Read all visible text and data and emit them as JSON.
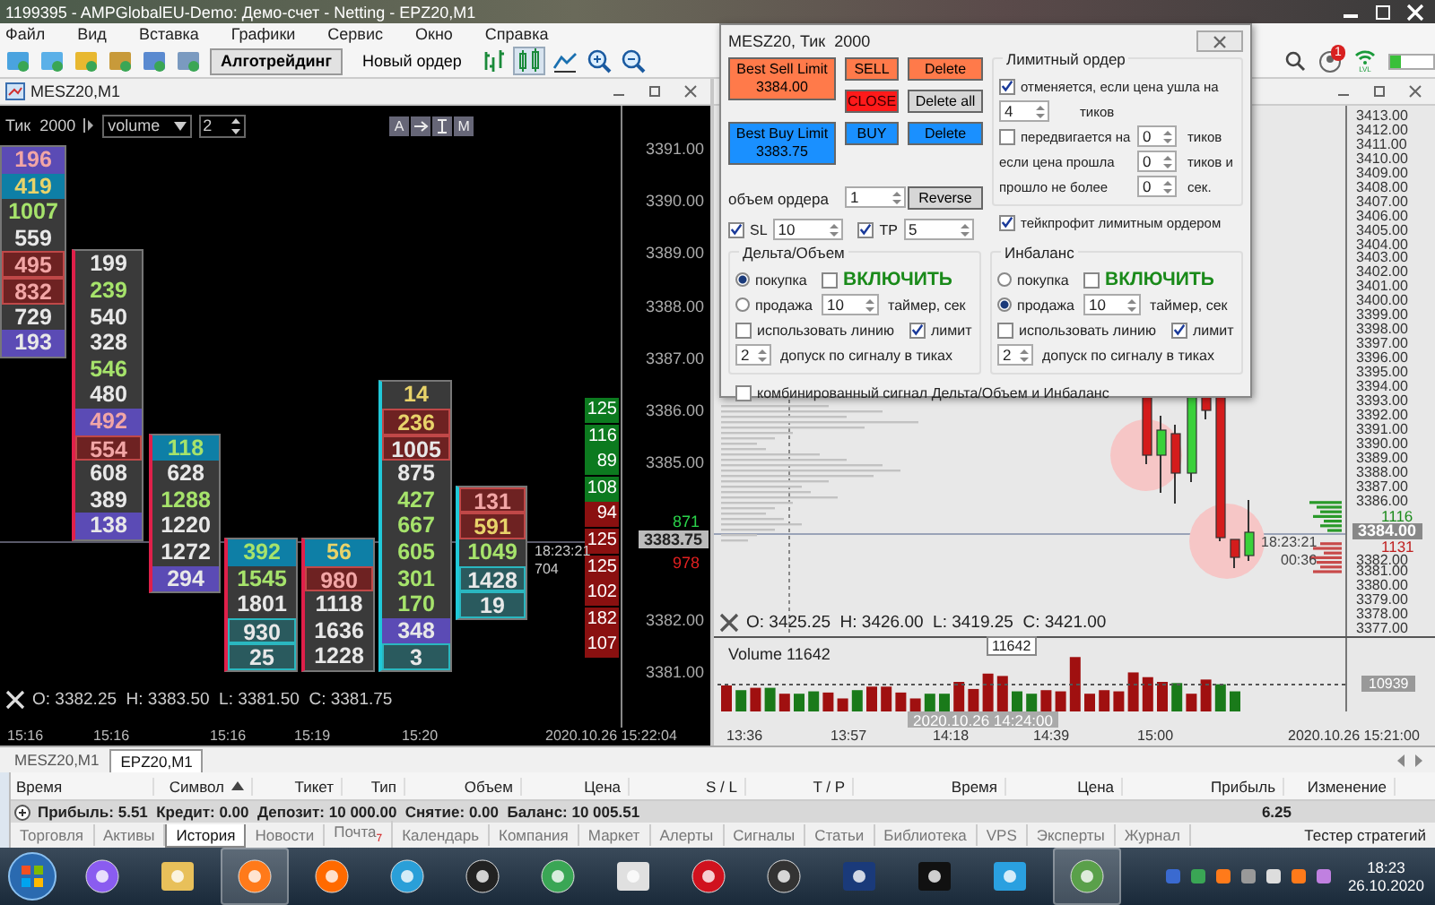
{
  "window": {
    "title": "1199395 - AMPGlobalEU-Demo: Демо-счет - Netting - EPZ20,M1"
  },
  "menu": [
    "Файл",
    "Вид",
    "Вставка",
    "Графики",
    "Сервис",
    "Окно",
    "Справка"
  ],
  "toolbar": {
    "buttons": [
      {
        "label": "Алготрейдинг",
        "selected": true
      },
      {
        "label": "Новый ордер",
        "selected": false
      }
    ],
    "notifications": "1",
    "signal_label": "LVL"
  },
  "left_chart": {
    "title": "MESZ20,M1",
    "period": "Тик  2000",
    "mode": "volume",
    "step": "2",
    "tools": [
      "A",
      "M"
    ],
    "columns": [
      {
        "kind": "plain",
        "cells": [
          {
            "value": "196",
            "kind": "purple-pink"
          },
          {
            "value": "419",
            "kind": "cyan-yellow"
          },
          {
            "value": "1007",
            "kind": "plain-green"
          },
          {
            "value": "559",
            "kind": "plain-white"
          },
          {
            "value": "495",
            "kind": "red-pink"
          },
          {
            "value": "832",
            "kind": "red-pink"
          },
          {
            "value": "729",
            "kind": "plain-white"
          },
          {
            "value": "193",
            "kind": "purple-white"
          }
        ]
      },
      {
        "kind": "sell",
        "cells": [
          {
            "value": "199",
            "kind": "plain-white"
          },
          {
            "value": "239",
            "kind": "plain-green"
          },
          {
            "value": "540",
            "kind": "plain-white"
          },
          {
            "value": "328",
            "kind": "plain-white"
          },
          {
            "value": "546",
            "kind": "plain-green"
          },
          {
            "value": "480",
            "kind": "plain-white"
          },
          {
            "value": "492",
            "kind": "purple-pink"
          },
          {
            "value": "554",
            "kind": "red-pink"
          },
          {
            "value": "608",
            "kind": "plain-white"
          },
          {
            "value": "389",
            "kind": "plain-white"
          },
          {
            "value": "138",
            "kind": "purple-white"
          }
        ]
      },
      {
        "kind": "sell",
        "cells": [
          {
            "value": "118",
            "kind": "cyan-green"
          },
          {
            "value": "628",
            "kind": "plain-white"
          },
          {
            "value": "1288",
            "kind": "plain-green"
          },
          {
            "value": "1220",
            "kind": "plain-white"
          },
          {
            "value": "1272",
            "kind": "plain-white"
          },
          {
            "value": "294",
            "kind": "purple-white"
          }
        ]
      },
      {
        "kind": "sell",
        "cells": [
          {
            "value": "392",
            "kind": "cyan-green"
          },
          {
            "value": "1545",
            "kind": "plain-green"
          },
          {
            "value": "1801",
            "kind": "plain-white"
          },
          {
            "value": "930",
            "kind": "teal-white"
          },
          {
            "value": "25",
            "kind": "teal-white"
          }
        ]
      },
      {
        "kind": "sell",
        "cells": [
          {
            "value": "56",
            "kind": "cyan-yellow"
          },
          {
            "value": "980",
            "kind": "red-pink"
          },
          {
            "value": "1118",
            "kind": "plain-white"
          },
          {
            "value": "1636",
            "kind": "plain-white"
          },
          {
            "value": "1228",
            "kind": "plain-white"
          }
        ]
      },
      {
        "kind": "buy",
        "cells": [
          {
            "value": "14",
            "kind": "plain-yellow"
          },
          {
            "value": "236",
            "kind": "red-yellow"
          },
          {
            "value": "1005",
            "kind": "red-white"
          },
          {
            "value": "875",
            "kind": "plain-white"
          },
          {
            "value": "427",
            "kind": "plain-green"
          },
          {
            "value": "667",
            "kind": "plain-green"
          },
          {
            "value": "605",
            "kind": "plain-green"
          },
          {
            "value": "301",
            "kind": "plain-green"
          },
          {
            "value": "170",
            "kind": "plain-green"
          },
          {
            "value": "348",
            "kind": "purple-white"
          },
          {
            "value": "3",
            "kind": "teal-white"
          }
        ]
      },
      {
        "kind": "buy",
        "cells": [
          {
            "value": "131",
            "kind": "red-pink"
          },
          {
            "value": "591",
            "kind": "red-yellow"
          },
          {
            "value": "1049",
            "kind": "plain-green"
          },
          {
            "value": "1428",
            "kind": "teal-white"
          },
          {
            "value": "19",
            "kind": "teal-white"
          }
        ]
      }
    ],
    "dom": [
      {
        "value": "125",
        "kind": "buy"
      },
      {
        "value": "116",
        "kind": "buy"
      },
      {
        "value": "89",
        "kind": "buy"
      },
      {
        "value": "108",
        "kind": "buy"
      },
      {
        "value": "94",
        "kind": "sell"
      },
      {
        "value": "125",
        "kind": "sell"
      },
      {
        "value": "125",
        "kind": "sell"
      },
      {
        "value": "102",
        "kind": "sell"
      },
      {
        "value": "182",
        "kind": "sell"
      },
      {
        "value": "107",
        "kind": "sell"
      }
    ],
    "price_labels": [
      "3391.00",
      "3390.00",
      "3389.00",
      "3388.00",
      "3387.00",
      "3386.00",
      "3385.00",
      "3382.00",
      "3381.00"
    ],
    "last_price": "3383.75",
    "bid_volume": "871",
    "ask_volume": "978",
    "time": "18:23:21",
    "tick_count": "704",
    "ohlc": "O: 3382.25  H: 3383.50  L: 3381.50  C: 3381.75",
    "time_labels": [
      "15:16",
      "15:16",
      "15:16",
      "15:19",
      "15:20",
      "2020.10.26 15:22:04"
    ]
  },
  "right_chart": {
    "price_labels": [
      "3413.00",
      "3412.00",
      "3411.00",
      "3410.00",
      "3409.00",
      "3408.00",
      "3407.00",
      "3406.00",
      "3405.00",
      "3404.00",
      "3403.00",
      "3402.00",
      "3401.00",
      "3400.00",
      "3399.00",
      "3398.00",
      "3397.00",
      "3396.00",
      "3395.00",
      "3394.00",
      "3393.00",
      "3392.00",
      "3391.00",
      "3390.00",
      "3389.00",
      "3388.00",
      "3387.00",
      "3386.00",
      "3382.00",
      "3381.00",
      "3380.00",
      "3379.00",
      "3378.00",
      "3377.00"
    ],
    "last_price": "3384.00",
    "bid_volume": "1116",
    "ask_volume": "1131",
    "time": "18:23:21",
    "countdown": "00:36",
    "ohlc": "O: 3425.25  H: 3426.00  L: 3419.25  C: 3421.00",
    "volume_title": "Volume 11642",
    "volume_tooltip": "11642",
    "volume_level": "10939",
    "cursor_date": "2020.10.26 14:24:00",
    "time_labels": [
      "13:36",
      "13:57",
      "14:18",
      "14:39",
      "15:00",
      "2020.10.26 15:21:00"
    ]
  },
  "order_dialog": {
    "title": "MESZ20, Тик  2000",
    "buttons": [
      {
        "label": "Best Sell Limit",
        "price": "3384.00",
        "kind": "sell"
      },
      {
        "label": "SELL",
        "kind": "sell"
      },
      {
        "label": "Delete",
        "kind": "sell"
      },
      {
        "label": "CLOSE",
        "kind": "close"
      },
      {
        "label": "Delete all",
        "kind": "neutral"
      },
      {
        "label": "Best Buy Limit",
        "price": "3383.75",
        "kind": "buy"
      },
      {
        "label": "BUY",
        "kind": "buy"
      },
      {
        "label": "Delete",
        "kind": "buy"
      },
      {
        "label": "Reverse",
        "kind": "neutral"
      }
    ],
    "volume": {
      "label": "объем ордера",
      "value": "1"
    },
    "sl": {
      "label": "SL",
      "checked": true,
      "value": "10"
    },
    "tp": {
      "label": "TP",
      "checked": true,
      "value": "5"
    },
    "limit_order": {
      "title": "Лимитный ордер",
      "cancel": {
        "label": "отменяется, если цена ушла на",
        "checked": true,
        "value": "4",
        "unit": "тиков"
      },
      "move": {
        "label": "передвигается на",
        "checked": false,
        "value": "0",
        "unit": "тиков"
      },
      "passed": {
        "label": "если цена прошла",
        "value": "0",
        "unit": "тиков и"
      },
      "elapsed": {
        "label": "прошло не более",
        "value": "0",
        "unit": "сек."
      },
      "take_profit": {
        "label": "тейкпрофит лимитным ордером",
        "checked": true
      }
    },
    "signals": [
      {
        "title": "Дельта/Объем",
        "buy": {
          "label": "покупка",
          "selected": true
        },
        "sell": {
          "label": "продажа",
          "selected": false
        },
        "enable": {
          "label": "ВКЛЮЧИТЬ",
          "checked": false
        },
        "timer": {
          "value": "10",
          "label": "таймер, сек"
        },
        "use_line": {
          "label": "использовать линию",
          "checked": false
        },
        "limit": {
          "label": "лимит",
          "checked": true
        },
        "tolerance": {
          "value": "2",
          "label": "допуск по сигналу в тиках"
        }
      },
      {
        "title": "Инбаланс",
        "buy": {
          "label": "покупка",
          "selected": false
        },
        "sell": {
          "label": "продажа",
          "selected": true
        },
        "enable": {
          "label": "ВКЛЮЧИТЬ",
          "checked": false
        },
        "timer": {
          "value": "10",
          "label": "таймер, сек"
        },
        "use_line": {
          "label": "использовать линию",
          "checked": false
        },
        "limit": {
          "label": "лимит",
          "checked": true
        },
        "tolerance": {
          "value": "2",
          "label": "допуск по сигналу в тиках"
        }
      }
    ],
    "combined": {
      "label": "комбинированный сигнал Дельта/Объем и Инбаланс",
      "checked": false
    }
  },
  "chart_tabs": [
    {
      "label": "MESZ20,M1",
      "selected": false
    },
    {
      "label": "EPZ20,M1",
      "selected": true
    }
  ],
  "table": {
    "columns": [
      {
        "label": "Время",
        "sorted": false
      },
      {
        "label": "Символ",
        "sorted": true
      },
      {
        "label": "Тикет",
        "sorted": false
      },
      {
        "label": "Тип",
        "sorted": false
      },
      {
        "label": "Объем",
        "sorted": false
      },
      {
        "label": "Цена",
        "sorted": false
      },
      {
        "label": "S / L",
        "sorted": false
      },
      {
        "label": "T / P",
        "sorted": false
      },
      {
        "label": "Время",
        "sorted": false
      },
      {
        "label": "Цена",
        "sorted": false
      },
      {
        "label": "Прибыль",
        "sorted": false
      },
      {
        "label": "Изменение",
        "sorted": false
      }
    ],
    "summary": "Прибыль: 5.51  Кредит: 0.00  Депозит: 10 000.00  Снятие: 0.00  Баланс: 10 005.51",
    "profit": "6.25"
  },
  "terminal_tabs": [
    {
      "label": "Торговля",
      "selected": false
    },
    {
      "label": "Активы",
      "selected": false
    },
    {
      "label": "История",
      "selected": true
    },
    {
      "label": "Новости",
      "selected": false
    },
    {
      "label": "Почта",
      "selected": false,
      "badge": "7"
    },
    {
      "label": "Календарь",
      "selected": false
    },
    {
      "label": "Компания",
      "selected": false
    },
    {
      "label": "Маркет",
      "selected": false
    },
    {
      "label": "Алерты",
      "selected": false
    },
    {
      "label": "Сигналы",
      "selected": false
    },
    {
      "label": "Статьи",
      "selected": false
    },
    {
      "label": "Библиотека",
      "selected": false
    },
    {
      "label": "VPS",
      "selected": false
    },
    {
      "label": "Эксперты",
      "selected": false
    },
    {
      "label": "Журнал",
      "selected": false
    }
  ],
  "strategy_tester": "Тестер стратегий",
  "taskbar": {
    "time": "18:23",
    "date": "26.10.2020"
  }
}
